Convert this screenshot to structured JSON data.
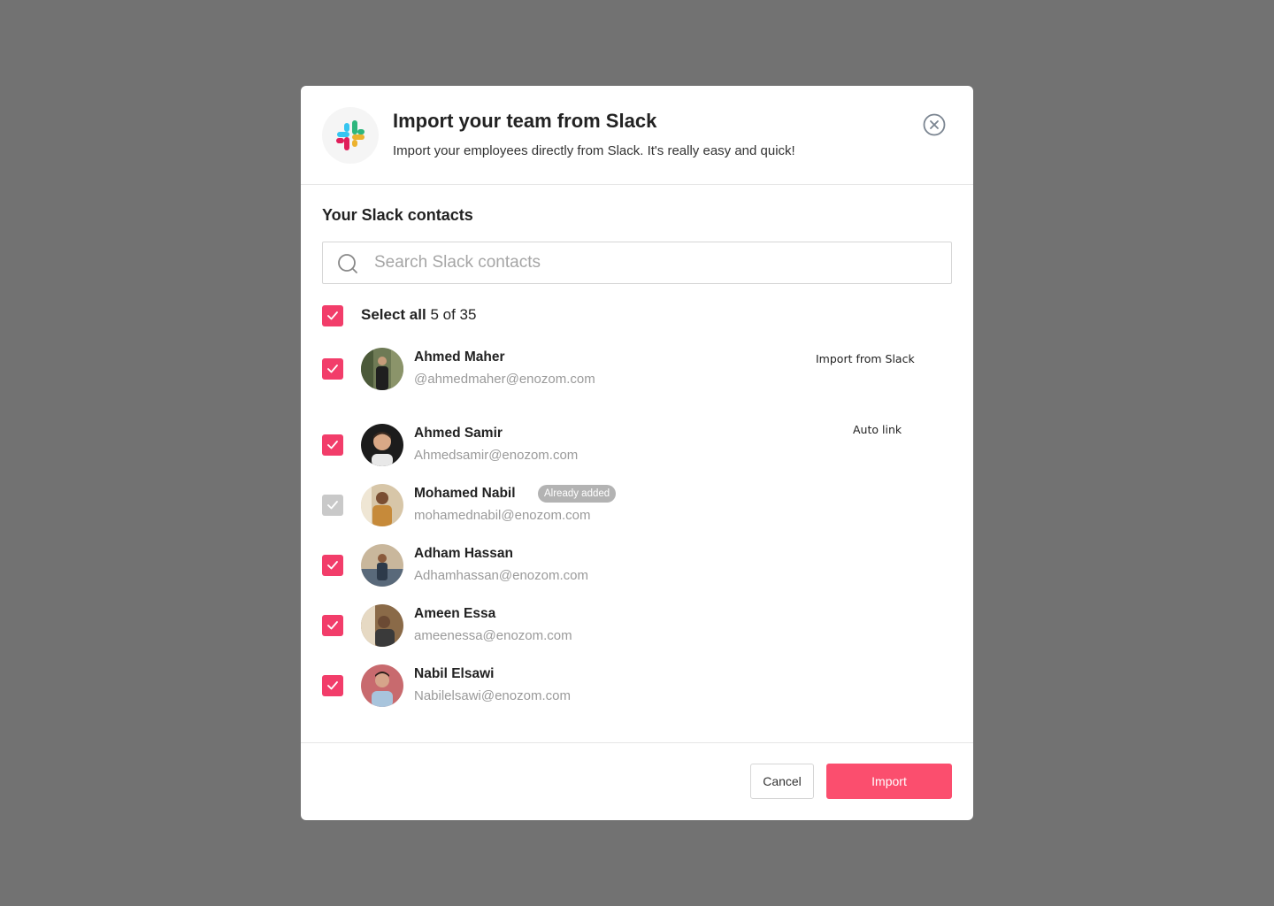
{
  "header": {
    "title": "Import your team from Slack",
    "subtitle": "Import your employees directly from Slack. It's really easy and quick!",
    "logo_icon": "slack-logo-icon",
    "close_icon": "close-circle-icon"
  },
  "contacts_section": {
    "title": "Your Slack contacts",
    "search_placeholder": "Search Slack contacts",
    "search_value": "",
    "select_all_label": "Select all",
    "selected_count": "5 of 35",
    "select_all_checked": true
  },
  "contacts": [
    {
      "name": "Ahmed Maher",
      "email": "@ahmedmaher@enozom.com",
      "checked": true,
      "disabled": false,
      "badge": ""
    },
    {
      "name": "Ahmed Samir",
      "email": "Ahmedsamir@enozom.com",
      "checked": true,
      "disabled": false,
      "badge": ""
    },
    {
      "name": "Mohamed Nabil",
      "email": "mohamednabil@enozom.com",
      "checked": true,
      "disabled": true,
      "badge": "Already added"
    },
    {
      "name": "Adham Hassan",
      "email": "Adhamhassan@enozom.com",
      "checked": true,
      "disabled": false,
      "badge": ""
    },
    {
      "name": "Ameen Essa",
      "email": "ameenessa@enozom.com",
      "checked": true,
      "disabled": false,
      "badge": ""
    },
    {
      "name": "Nabil Elsawi",
      "email": "Nabilelsawi@enozom.com",
      "checked": true,
      "disabled": false,
      "badge": ""
    }
  ],
  "annotations": {
    "import_from_slack": "Import from Slack",
    "auto_link": "Auto link"
  },
  "footer": {
    "cancel_label": "Cancel",
    "import_label": "Import"
  },
  "colors": {
    "backdrop": "#727272",
    "accent": "#f23d6a",
    "import_button": "#fb4e6e",
    "disabled_checkbox": "#c9c9c9",
    "badge": "#b3b3b3"
  }
}
